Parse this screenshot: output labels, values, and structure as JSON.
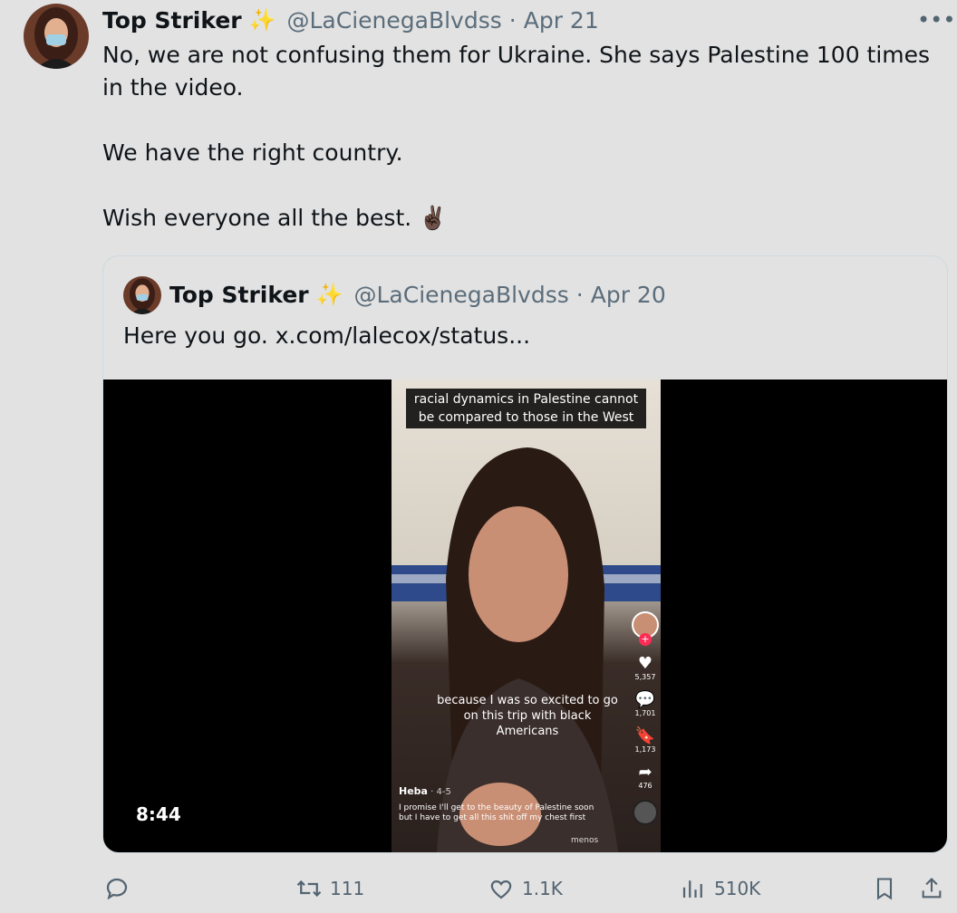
{
  "tweet": {
    "author_name": "Top Striker",
    "author_handle": "@LaCienegaBlvdss",
    "date": "Apr 21",
    "lines": [
      "No, we are not confusing them for Ukraine. She says Palestine 100 times in the video.",
      "We have the right country.",
      "Wish everyone all the best. ✌🏿"
    ]
  },
  "quoted": {
    "author_name": "Top Striker",
    "author_handle": "@LaCienegaBlvdss",
    "date": "Apr 20",
    "text": "Here you go.  x.com/lalecox/status...",
    "video": {
      "duration": "8:44",
      "caption_top": "racial dynamics in Palestine cannot be compared to those in the West",
      "caption_mid": "because I was so excited to go on this trip with black Americans",
      "creator_name": "Heba",
      "creator_date": "4-5",
      "creator_desc": "I promise I'll get to the beauty of Palestine soon but I have to get all this shit off my chest first",
      "menos": "menos",
      "likes": "5,357",
      "comments": "1,701",
      "saves": "1,173",
      "shares": "476"
    }
  },
  "actions": {
    "retweets": "111",
    "likes": "1.1K",
    "views": "510K"
  },
  "colors": {
    "background": "#e2e2e2",
    "muted": "#536471",
    "sparkle": "#f5c518"
  }
}
